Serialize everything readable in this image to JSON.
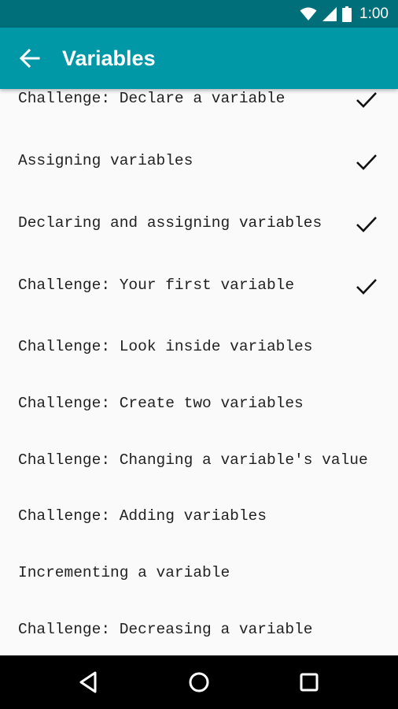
{
  "status_bar": {
    "time": "1:00"
  },
  "app_bar": {
    "title": "Variables"
  },
  "list": {
    "items": [
      {
        "label": "Challenge: Declare a variable",
        "completed": true
      },
      {
        "label": "Assigning variables",
        "completed": true
      },
      {
        "label": "Declaring and assigning variables",
        "completed": true
      },
      {
        "label": "Challenge: Your first variable",
        "completed": true
      },
      {
        "label": "Challenge: Look inside variables",
        "completed": false
      },
      {
        "label": "Challenge: Create two variables",
        "completed": false
      },
      {
        "label": "Challenge: Changing a variable's value",
        "completed": false
      },
      {
        "label": "Challenge: Adding variables",
        "completed": false
      },
      {
        "label": "Incrementing a variable",
        "completed": false
      },
      {
        "label": "Challenge: Decreasing a variable",
        "completed": false
      }
    ]
  },
  "colors": {
    "status_bar": "#006f79",
    "app_bar": "#0097a7",
    "background": "#fafafa",
    "nav_bar": "#000000"
  }
}
